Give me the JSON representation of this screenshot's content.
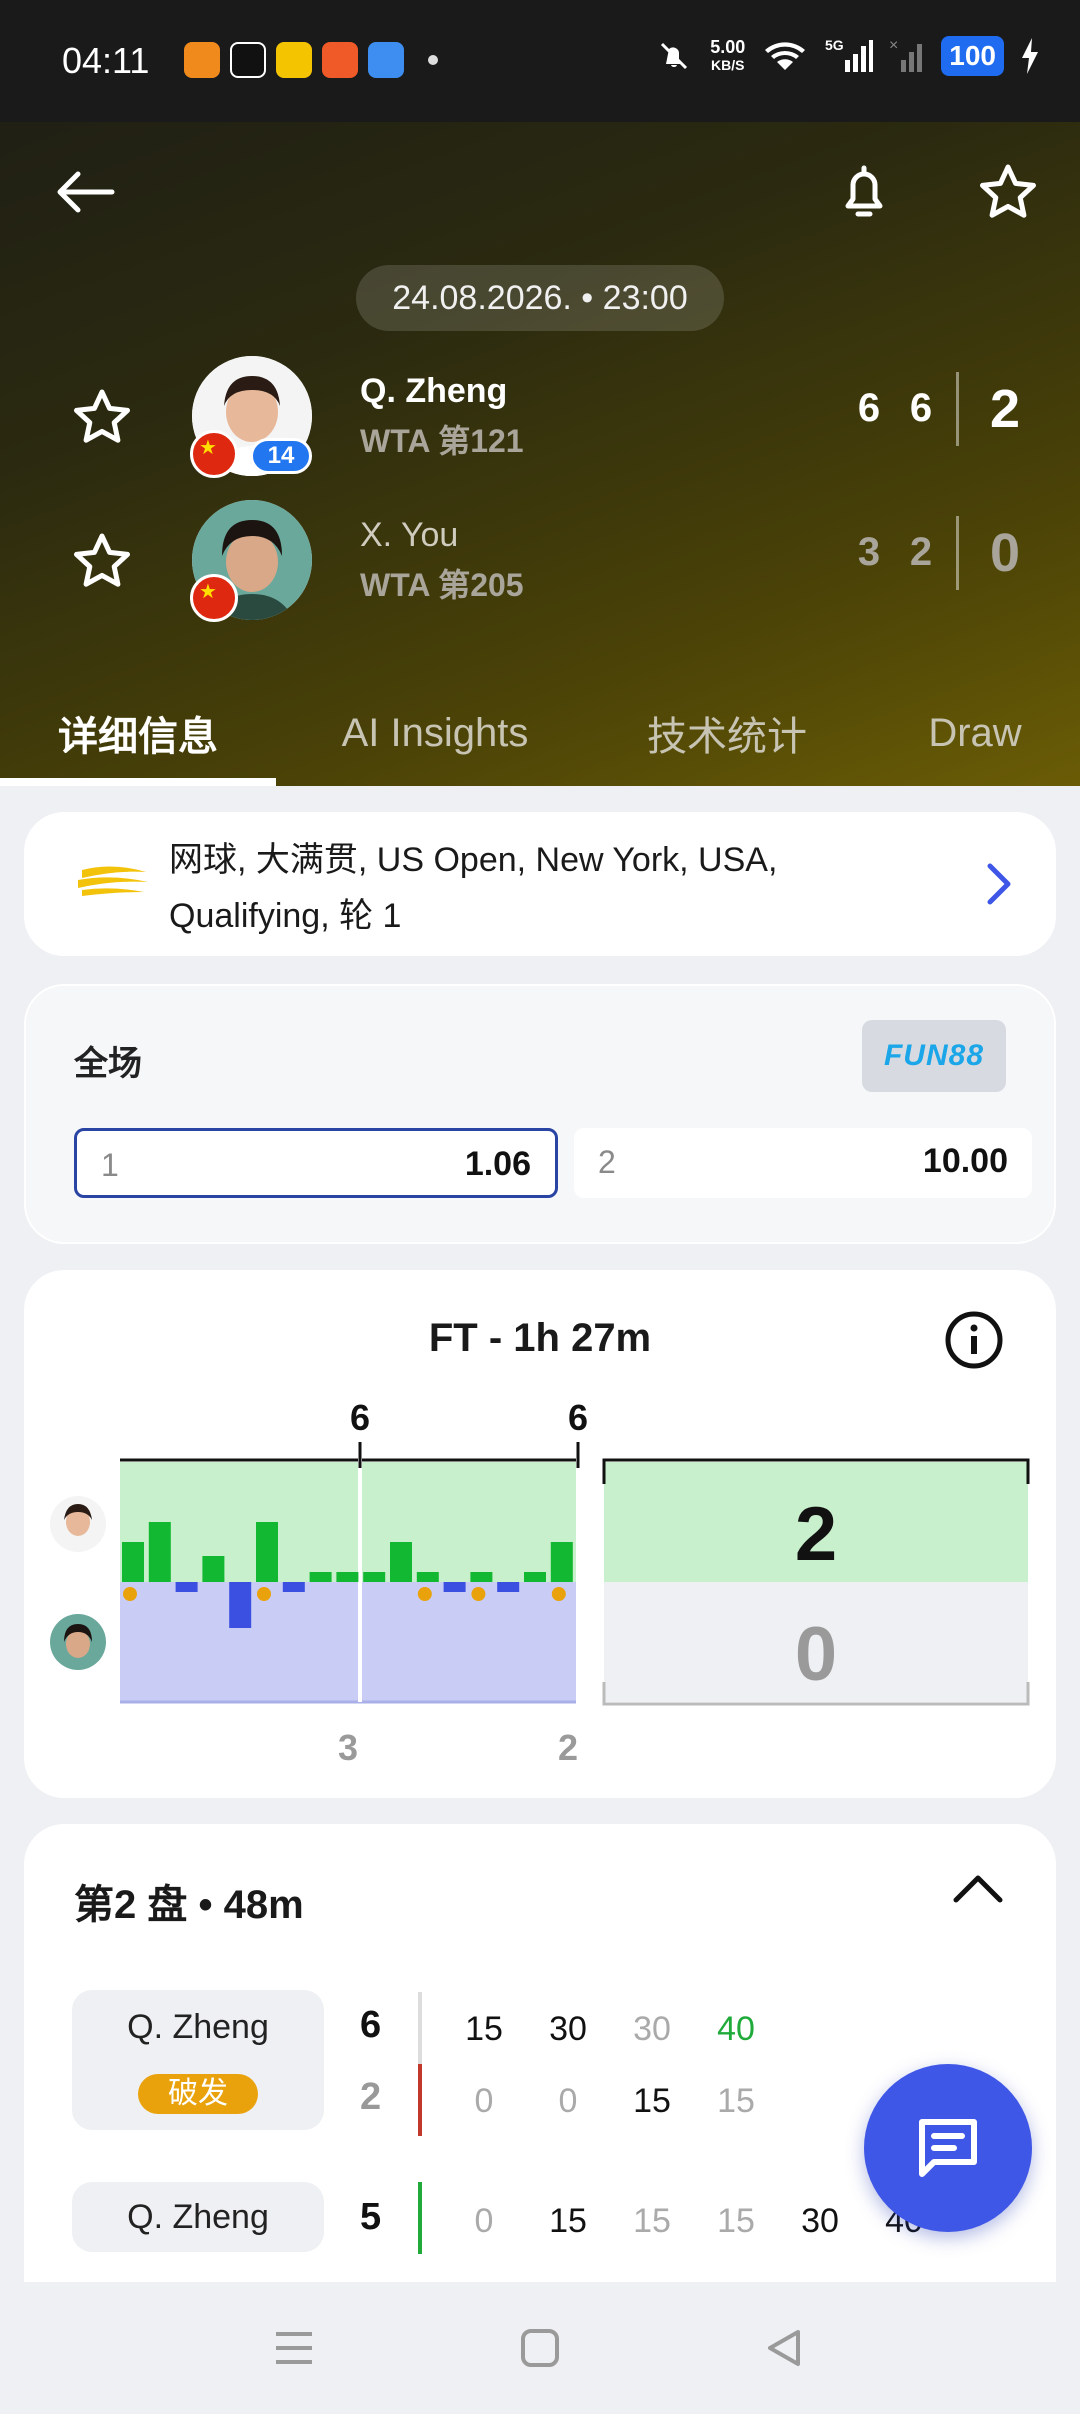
{
  "status_bar": {
    "time": "04:11",
    "speed_value": "5.00",
    "speed_unit": "KB/S",
    "network": "5G",
    "battery": "100"
  },
  "header": {
    "datetime": "24.08.2026. • 23:00"
  },
  "players": [
    {
      "name": "Q. Zheng",
      "rank": "WTA 第121",
      "seed": "14",
      "sets": [
        "6",
        "6"
      ],
      "total": "2"
    },
    {
      "name": "X. You",
      "rank": "WTA 第205",
      "sets": [
        "3",
        "2"
      ],
      "total": "0"
    }
  ],
  "tabs": [
    "详细信息",
    "AI Insights",
    "技术统计",
    "Draw"
  ],
  "league": {
    "text": "网球, 大满贯, US Open, New York, USA, Qualifying, 轮 1"
  },
  "odds": {
    "title": "全场",
    "bookmaker": "FUN88",
    "options": [
      {
        "label": "1",
        "value": "1.06"
      },
      {
        "label": "2",
        "value": "10.00"
      }
    ]
  },
  "momentum": {
    "title": "FT - 1h 27m",
    "set_scores_top": [
      "6",
      "6"
    ],
    "set_scores_bottom": [
      "3",
      "2"
    ],
    "total_top": "2",
    "total_bottom": "0",
    "colors": {
      "p1": "#13b832",
      "p2": "#3b4fe0",
      "p1_bg": "#c8f0cc",
      "p2_bg": "#c9cdf6"
    },
    "bars": [
      2,
      3,
      -0.5,
      1.3,
      -2.3,
      3,
      -0.5,
      0.5,
      0.5,
      0.5,
      2,
      0.5,
      -0.5,
      0.5,
      -0.5,
      0.5,
      2
    ]
  },
  "set_detail": {
    "title": "第2 盘 • 48m",
    "games": [
      {
        "server": "Q. Zheng",
        "badge": "破发",
        "top_score": "6",
        "bottom_score": "2",
        "top_points": [
          "15",
          "30",
          "30",
          "40"
        ],
        "bottom_points": [
          "0",
          "0",
          "15",
          "15"
        ]
      },
      {
        "server": "Q. Zheng",
        "top_score": "5",
        "top_points": [
          "0",
          "15",
          "15",
          "15",
          "30",
          "40"
        ]
      }
    ]
  }
}
